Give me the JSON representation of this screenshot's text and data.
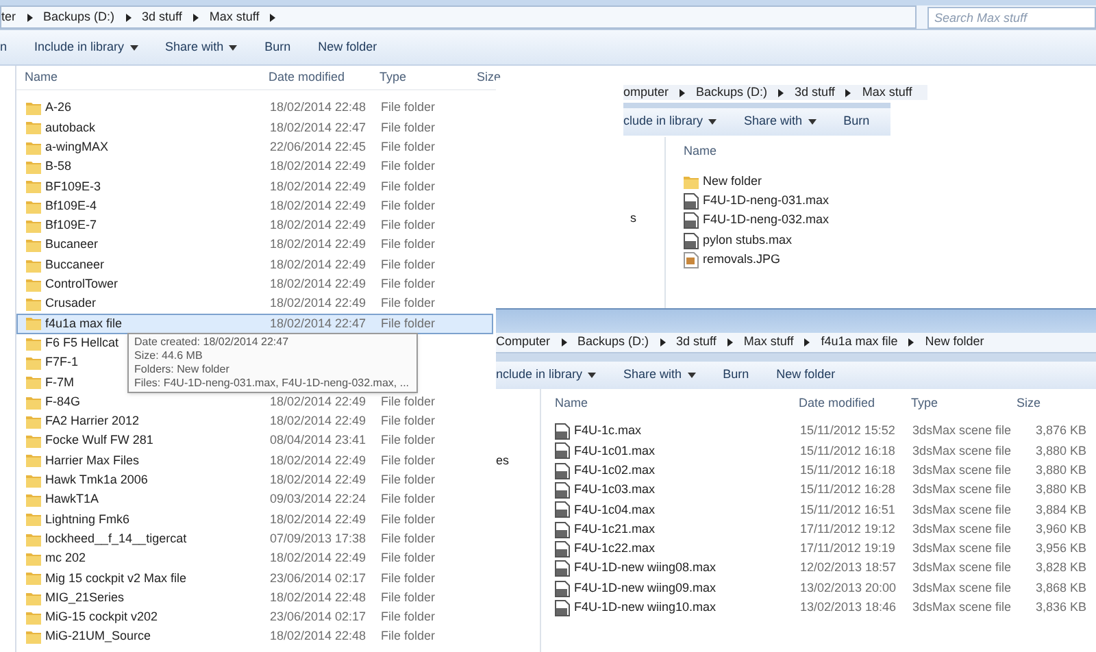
{
  "main_window": {
    "breadcrumb": [
      "ter",
      "Backups (D:)",
      "3d stuff",
      "Max stuff"
    ],
    "search": {
      "placeholder": "Search Max stuff"
    },
    "toolbar": [
      {
        "label": "n",
        "dropdown": false
      },
      {
        "label": "Include in library",
        "dropdown": true
      },
      {
        "label": "Share with",
        "dropdown": true
      },
      {
        "label": "Burn",
        "dropdown": false
      },
      {
        "label": "New folder",
        "dropdown": false
      }
    ],
    "columns": [
      "Name",
      "Date modified",
      "Type",
      "Size"
    ],
    "rows": [
      {
        "name": "A-26",
        "date": "18/02/2014 22:48",
        "type": "File folder",
        "selected": false
      },
      {
        "name": "autoback",
        "date": "18/02/2014 22:47",
        "type": "File folder",
        "selected": false
      },
      {
        "name": "a-wingMAX",
        "date": "22/06/2014 22:45",
        "type": "File folder",
        "selected": false
      },
      {
        "name": "B-58",
        "date": "18/02/2014 22:49",
        "type": "File folder",
        "selected": false
      },
      {
        "name": "BF109E-3",
        "date": "18/02/2014 22:49",
        "type": "File folder",
        "selected": false
      },
      {
        "name": "Bf109E-4",
        "date": "18/02/2014 22:49",
        "type": "File folder",
        "selected": false
      },
      {
        "name": "Bf109E-7",
        "date": "18/02/2014 22:49",
        "type": "File folder",
        "selected": false
      },
      {
        "name": "Bucaneer",
        "date": "18/02/2014 22:49",
        "type": "File folder",
        "selected": false
      },
      {
        "name": "Buccaneer",
        "date": "18/02/2014 22:49",
        "type": "File folder",
        "selected": false
      },
      {
        "name": "ControlTower",
        "date": "18/02/2014 22:49",
        "type": "File folder",
        "selected": false
      },
      {
        "name": "Crusader",
        "date": "18/02/2014 22:49",
        "type": "File folder",
        "selected": false
      },
      {
        "name": "f4u1a max file",
        "date": "18/02/2014 22:47",
        "type": "File folder",
        "selected": true
      },
      {
        "name": "F6 F5 Hellcat",
        "selected": false
      },
      {
        "name": "F7F-1",
        "selected": false
      },
      {
        "name": "F-7M",
        "selected": false
      },
      {
        "name": "F-84G",
        "date": "18/02/2014 22:49",
        "type": "File folder",
        "selected": false
      },
      {
        "name": "FA2 Harrier 2012",
        "date": "18/02/2014 22:49",
        "type": "File folder",
        "selected": false
      },
      {
        "name": "Focke Wulf FW 281",
        "date": "08/04/2014 23:41",
        "type": "File folder",
        "selected": false
      },
      {
        "name": "Harrier Max Files",
        "date": "18/02/2014 22:49",
        "type": "File folder",
        "selected": false
      },
      {
        "name": "Hawk Tmk1a 2006",
        "date": "18/02/2014 22:49",
        "type": "File folder",
        "selected": false
      },
      {
        "name": "HawkT1A",
        "date": "09/03/2014 22:24",
        "type": "File folder",
        "selected": false
      },
      {
        "name": "Lightning Fmk6",
        "date": "18/02/2014 22:49",
        "type": "File folder",
        "selected": false
      },
      {
        "name": "lockheed__f_14__tigercat",
        "date": "07/09/2013 17:38",
        "type": "File folder",
        "selected": false
      },
      {
        "name": "mc 202",
        "date": "18/02/2014 22:49",
        "type": "File folder",
        "selected": false
      },
      {
        "name": "Mig 15 cockpit v2 Max file",
        "date": "23/06/2014 02:17",
        "type": "File folder",
        "selected": false
      },
      {
        "name": "MIG_21Series",
        "date": "18/02/2014 22:48",
        "type": "File folder",
        "selected": false
      },
      {
        "name": "MiG-15 cockpit v202",
        "date": "23/06/2014 02:17",
        "type": "File folder",
        "selected": false
      },
      {
        "name": "MiG-21UM_Source",
        "date": "18/02/2014 22:48",
        "type": "File folder",
        "selected": false
      }
    ]
  },
  "tooltip": {
    "lines": [
      "Date created: 18/02/2014 22:47",
      "Size: 44.6 MB",
      "Folders: New folder",
      "Files: F4U-1D-neng-031.max, F4U-1D-neng-032.max, ..."
    ]
  },
  "window_2": {
    "breadcrumb": [
      "omputer",
      "Backups (D:)",
      "3d stuff",
      "Max stuff"
    ],
    "toolbar": [
      {
        "label": "clude in library",
        "dropdown": true
      },
      {
        "label": "Share with",
        "dropdown": true
      },
      {
        "label": "Burn",
        "dropdown": false
      }
    ],
    "nav_text": "s",
    "columns": [
      "Name"
    ],
    "rows": [
      {
        "name": "New folder",
        "kind": "folder"
      },
      {
        "name": "F4U-1D-neng-031.max",
        "kind": "max"
      },
      {
        "name": "F4U-1D-neng-032.max",
        "kind": "max"
      },
      {
        "name": "pylon stubs.max",
        "kind": "max"
      },
      {
        "name": "removals.JPG",
        "kind": "image"
      }
    ]
  },
  "window_3": {
    "breadcrumb": [
      "Computer",
      "Backups (D:)",
      "3d stuff",
      "Max stuff",
      "f4u1a max file",
      "New folder"
    ],
    "toolbar": [
      {
        "label": "nclude in library",
        "dropdown": true
      },
      {
        "label": "Share with",
        "dropdown": true
      },
      {
        "label": "Burn",
        "dropdown": false
      },
      {
        "label": "New folder",
        "dropdown": false
      }
    ],
    "nav_text": "es",
    "columns": [
      "Name",
      "Date modified",
      "Type",
      "Size"
    ],
    "rows": [
      {
        "name": "F4U-1c.max",
        "date": "15/11/2012 15:52",
        "type": "3dsMax scene file",
        "size": "3,876 KB"
      },
      {
        "name": "F4U-1c01.max",
        "date": "15/11/2012 16:18",
        "type": "3dsMax scene file",
        "size": "3,880 KB"
      },
      {
        "name": "F4U-1c02.max",
        "date": "15/11/2012 16:18",
        "type": "3dsMax scene file",
        "size": "3,880 KB"
      },
      {
        "name": "F4U-1c03.max",
        "date": "15/11/2012 16:28",
        "type": "3dsMax scene file",
        "size": "3,880 KB"
      },
      {
        "name": "F4U-1c04.max",
        "date": "15/11/2012 16:51",
        "type": "3dsMax scene file",
        "size": "3,884 KB"
      },
      {
        "name": "F4U-1c21.max",
        "date": "17/11/2012 19:12",
        "type": "3dsMax scene file",
        "size": "3,960 KB"
      },
      {
        "name": "F4U-1c22.max",
        "date": "17/11/2012 19:19",
        "type": "3dsMax scene file",
        "size": "3,956 KB"
      },
      {
        "name": "F4U-1D-new wiing08.max",
        "date": "12/02/2013 18:57",
        "type": "3dsMax scene file",
        "size": "3,828 KB"
      },
      {
        "name": "F4U-1D-new wiing09.max",
        "date": "13/02/2013 20:00",
        "type": "3dsMax scene file",
        "size": "3,868 KB"
      },
      {
        "name": "F4U-1D-new wiing10.max",
        "date": "13/02/2013 18:46",
        "type": "3dsMax scene file",
        "size": "3,836 KB"
      }
    ]
  }
}
